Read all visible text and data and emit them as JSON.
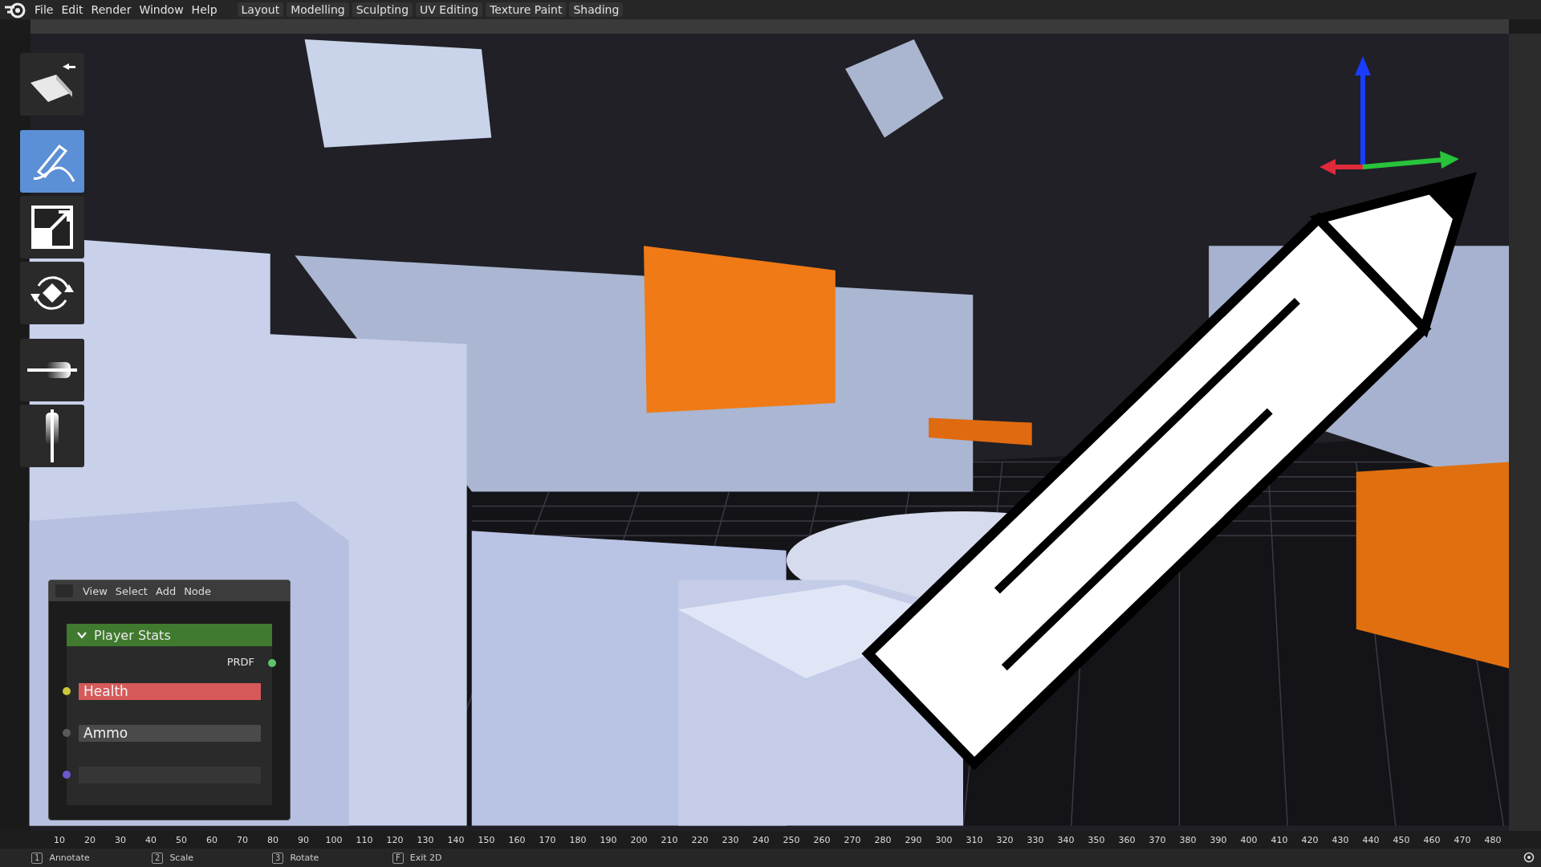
{
  "menu": [
    "File",
    "Edit",
    "Render",
    "Window",
    "Help"
  ],
  "workspaces": [
    {
      "label": "Layout",
      "selected": false
    },
    {
      "label": "Modelling",
      "selected": false
    },
    {
      "label": "Sculpting",
      "selected": false
    },
    {
      "label": "UV Editing",
      "selected": false
    },
    {
      "label": "Texture Paint",
      "selected": false
    },
    {
      "label": "Shading",
      "selected": false
    }
  ],
  "tools": [
    {
      "kind": "box-move",
      "selected": false
    },
    {
      "kind": "annotate",
      "selected": true
    },
    {
      "kind": "scale",
      "selected": false
    },
    {
      "kind": "rotate",
      "selected": false
    },
    {
      "kind": "slider-h",
      "selected": false
    },
    {
      "kind": "slider-v",
      "selected": false
    }
  ],
  "node_editor": {
    "menu": [
      "View",
      "Select",
      "Add",
      "Node"
    ],
    "node": {
      "title": "Player Stats",
      "expanded": true,
      "output": {
        "label": "PRDF",
        "color": "#5cc46a"
      },
      "inputs": [
        {
          "label": "Health",
          "color": "#c8c83a",
          "selected": true
        },
        {
          "label": "Ammo",
          "color": "#5a5a5a",
          "selected": false
        },
        {
          "color": "#6a5ad0",
          "selected": false
        }
      ]
    }
  },
  "timeline": [
    "10",
    "20",
    "30",
    "40",
    "50",
    "60",
    "70",
    "80",
    "90",
    "100",
    "110",
    "120",
    "130",
    "140",
    "150",
    "160",
    "170",
    "180",
    "190",
    "200",
    "210",
    "220",
    "230",
    "240",
    "250",
    "260",
    "270",
    "280",
    "290",
    "300",
    "310",
    "320",
    "330",
    "340",
    "350",
    "360",
    "370",
    "380",
    "390",
    "400",
    "410",
    "420",
    "430",
    "440",
    "450",
    "460",
    "470",
    "480"
  ],
  "status_bar": [
    {
      "key": "1",
      "label": "Annotate"
    },
    {
      "key": "2",
      "label": "Scale"
    },
    {
      "key": "3",
      "label": "Rotate"
    },
    {
      "key": "F",
      "label": "Exit 2D"
    }
  ]
}
